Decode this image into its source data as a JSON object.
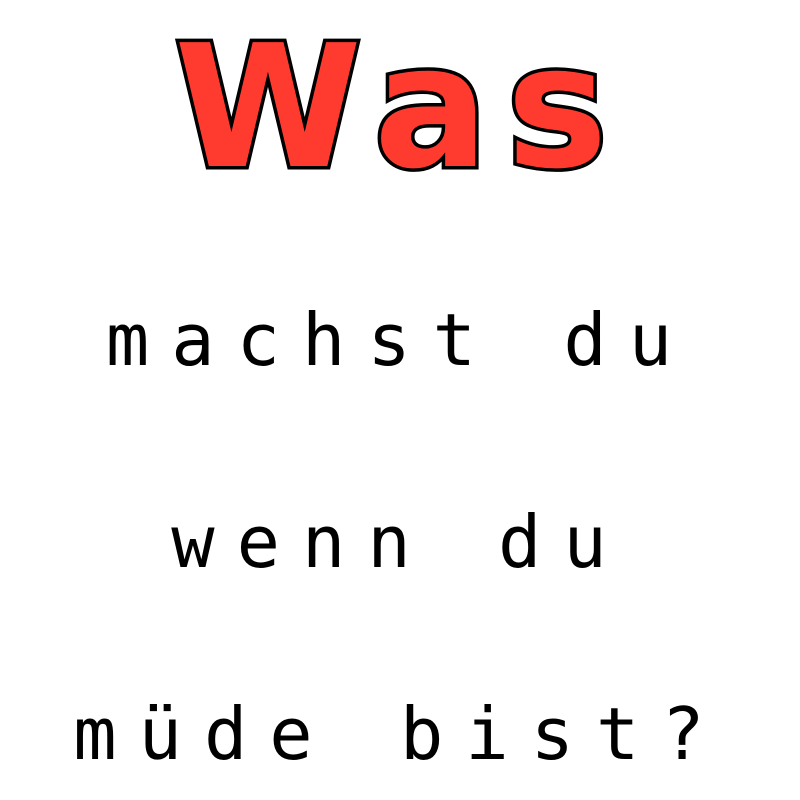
{
  "title": "Was",
  "lines": [
    "machst du",
    "wenn du",
    "müde bist?"
  ],
  "colors": {
    "title_fill": "#ff3b30",
    "title_outline": "#000000",
    "text": "#000000",
    "background": "#ffffff"
  }
}
